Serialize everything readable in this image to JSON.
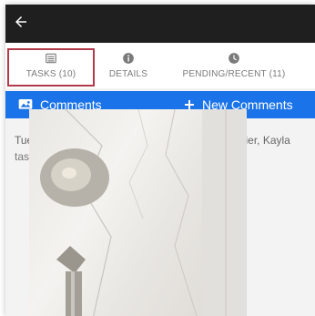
{
  "header": {
    "back_icon": "arrow-left-icon"
  },
  "tabs": [
    {
      "label": "TASKS (10)",
      "icon": "list-icon",
      "active": true
    },
    {
      "label": "DETAILS",
      "icon": "info-icon",
      "active": false
    },
    {
      "label": "PENDING/RECENT (11)",
      "icon": "clock-icon",
      "active": false
    }
  ],
  "actions": {
    "comments_label": "Comments",
    "new_comments_label": "New Comments"
  },
  "comment": {
    "timestamp_author": "Tuesday, December 5, 2023 5:48:38 AM by Lanier, Kayla",
    "text": "task 10 - tub is not caulked"
  },
  "colors": {
    "topbar": "#1f1f1f",
    "accent": "#1a73e8",
    "active_outline": "#b23a48",
    "tab_text": "#7a7a7a"
  }
}
